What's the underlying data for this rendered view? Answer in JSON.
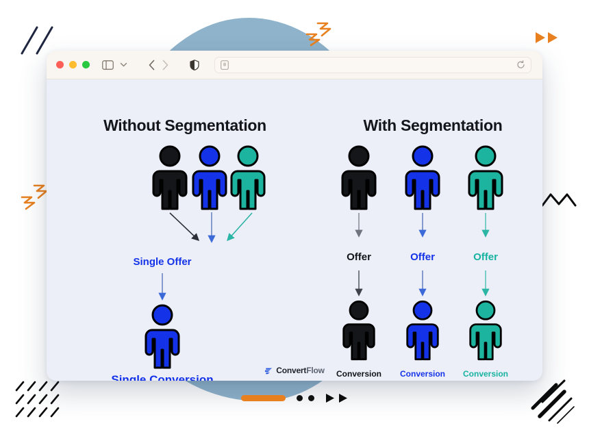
{
  "browser": {
    "traffic_lights": [
      "close",
      "minimize",
      "maximize"
    ],
    "toolbar": {
      "sidebar_icon": "sidebar-icon",
      "dropdown_icon": "chevron-down-icon",
      "back_icon": "chevron-left-icon",
      "forward_icon": "chevron-right-icon",
      "shield_icon": "shield-privacy-icon",
      "reader_icon": "reader-page-icon"
    },
    "address_bar": {
      "value": "",
      "placeholder": "",
      "reload_icon": "reload-icon"
    }
  },
  "left_panel": {
    "title": "Without Segmentation",
    "people": [
      {
        "name": "person-black",
        "color": "#141619"
      },
      {
        "name": "person-blue",
        "color": "#1433e8"
      },
      {
        "name": "person-teal",
        "color": "#1cb49e"
      }
    ],
    "offer_label": "Single Offer",
    "conversion_label": "Single Conversion",
    "conversion_person_color": "#1433e8",
    "arrow_colors": [
      "#2b2f38",
      "#6b86c4",
      "#2ab5a4"
    ]
  },
  "right_panel": {
    "title": "With Segmentation",
    "columns": [
      {
        "person_name": "person-black",
        "color": "#141619",
        "label_color": "#111418",
        "offer_label": "Offer",
        "conversion_label": "Conversion",
        "arrow_color": "#8a8f99"
      },
      {
        "person_name": "person-blue",
        "color": "#1433e8",
        "label_color": "#1433e8",
        "offer_label": "Offer",
        "conversion_label": "Conversion",
        "arrow_color": "#6b86c4"
      },
      {
        "person_name": "person-teal",
        "color": "#1cb49e",
        "label_color": "#16b3a0",
        "offer_label": "Offer",
        "conversion_label": "Conversion",
        "arrow_color": "#2ab5a4"
      }
    ]
  },
  "footer": {
    "logo_icon": "convertflow-swoosh-icon",
    "brand_bold": "Convert",
    "brand_light": "Flow"
  },
  "controls": {
    "progress_color": "#e8801f",
    "progress_label": "progress-bar",
    "dots": [
      "dot-1",
      "dot-2"
    ],
    "play_icons": [
      "play-icon",
      "play-icon"
    ]
  },
  "decorations": {
    "slashes_top_left": "diagonal-slashes-decoration",
    "zigzag_top": "orange-zigzag-decoration",
    "play_top_right": "orange-play-arrows-decoration",
    "zigzag_left": "orange-zigzag-decoration",
    "mountain_right": "black-zigzag-line-decoration",
    "grid_bottom_left": "slash-grid-decoration",
    "stripes_bottom_right": "diagonal-stripes-decoration",
    "blob": "blue-blob-background",
    "colors": {
      "orange": "#e8801f",
      "navy": "#1f2640",
      "black": "#0b0b0b",
      "blob": "#8fb3cb"
    }
  }
}
